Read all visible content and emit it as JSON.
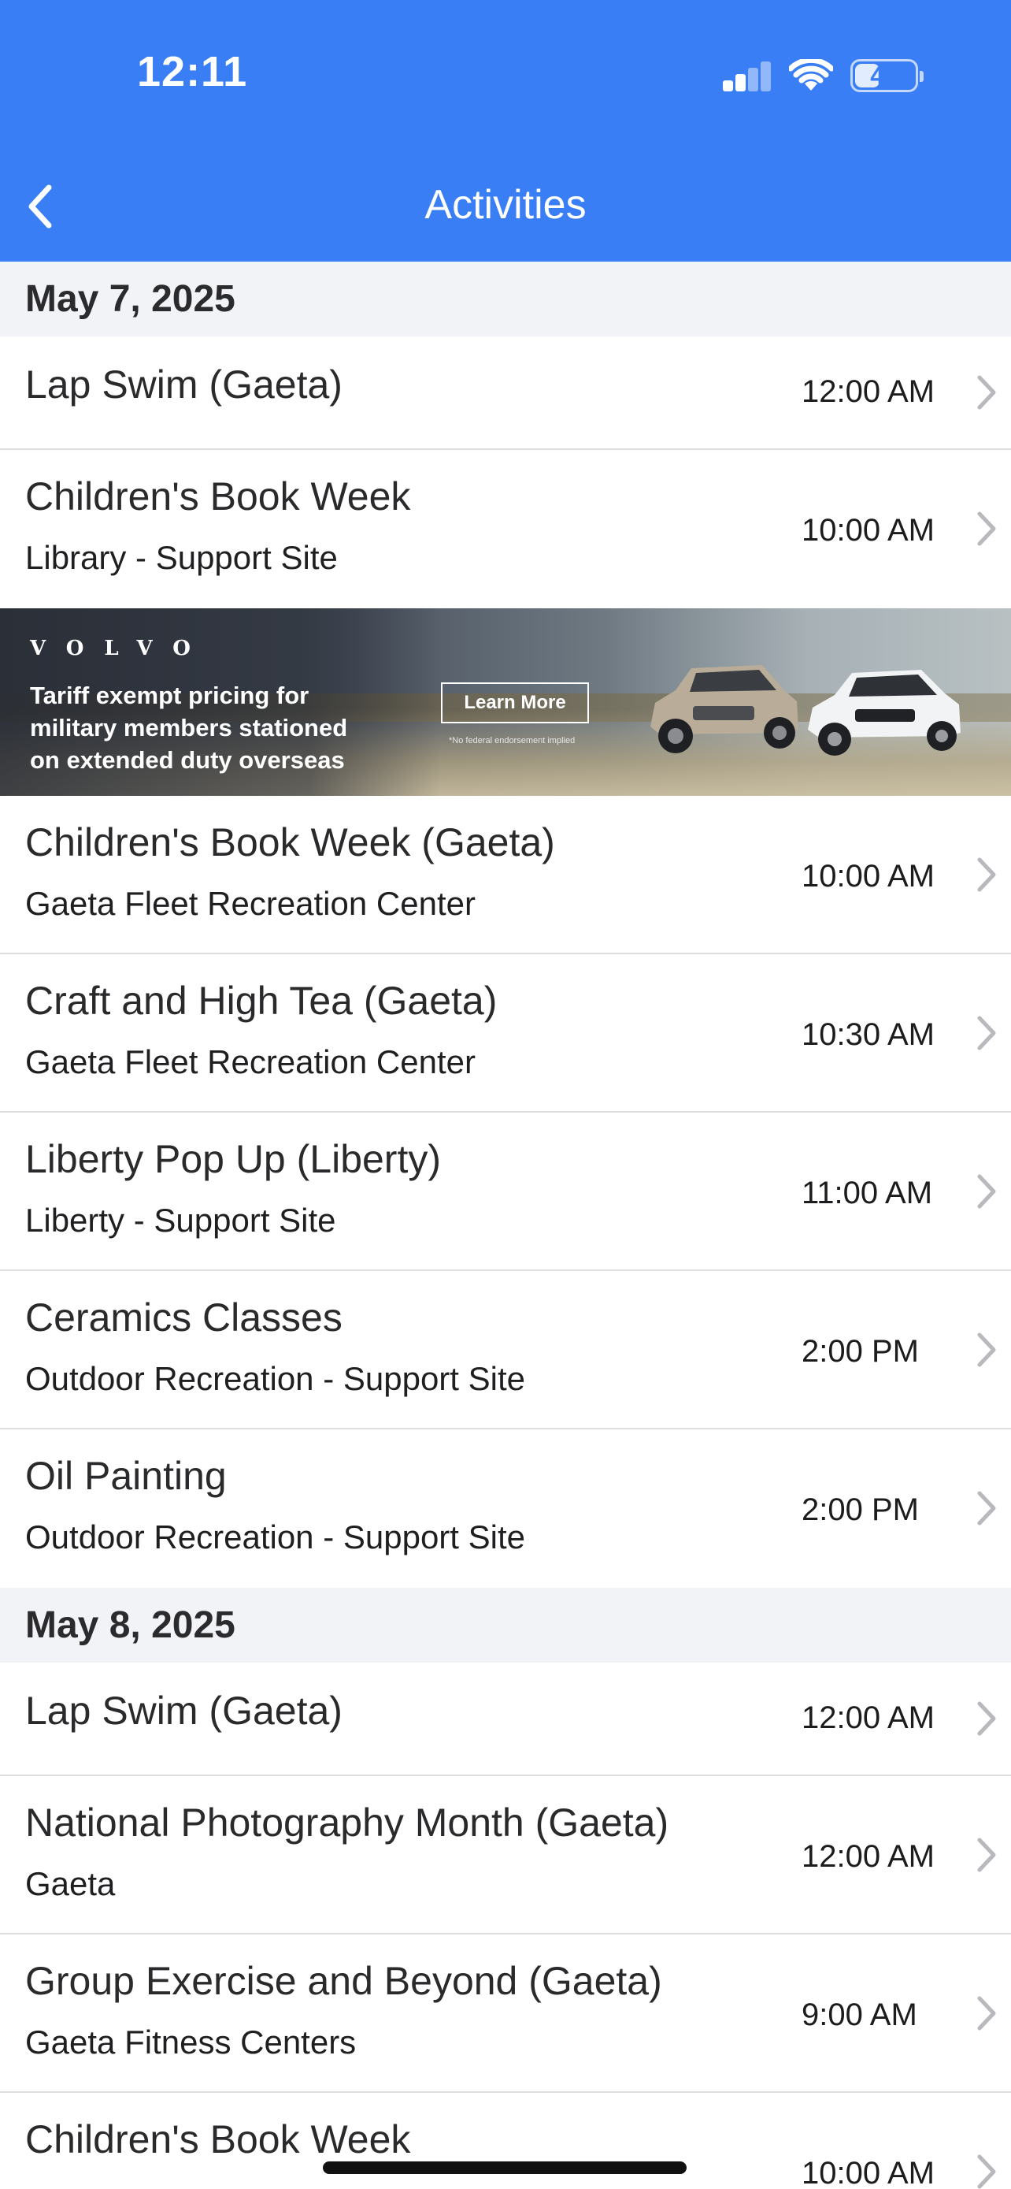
{
  "status_bar": {
    "time": "12:11",
    "battery": "42",
    "battery_level": 0.42
  },
  "nav": {
    "title": "Activities",
    "back_icon": "chevron-left-icon"
  },
  "sections": [
    {
      "date": "May 7, 2025",
      "rows_before_ad": [
        {
          "title": "Lap Swim (Gaeta)",
          "subtitle": "",
          "time": "12:00 AM"
        },
        {
          "title": "Children's Book Week",
          "subtitle": "Library - Support Site",
          "time": "10:00 AM"
        }
      ],
      "rows_after_ad": [
        {
          "title": "Children's Book Week (Gaeta)",
          "subtitle": "Gaeta Fleet Recreation Center",
          "time": "10:00 AM"
        },
        {
          "title": "Craft and High Tea (Gaeta)",
          "subtitle": "Gaeta Fleet Recreation Center",
          "time": "10:30 AM"
        },
        {
          "title": "Liberty Pop Up (Liberty)",
          "subtitle": "Liberty - Support Site",
          "time": "11:00 AM"
        },
        {
          "title": "Ceramics Classes",
          "subtitle": "Outdoor Recreation - Support Site",
          "time": "2:00 PM"
        },
        {
          "title": "Oil Painting",
          "subtitle": "Outdoor Recreation - Support Site",
          "time": "2:00 PM"
        }
      ]
    },
    {
      "date": "May 8, 2025",
      "rows": [
        {
          "title": "Lap Swim (Gaeta)",
          "subtitle": "",
          "time": "12:00 AM"
        },
        {
          "title": "National Photography Month (Gaeta)",
          "subtitle": "Gaeta",
          "time": "12:00 AM"
        },
        {
          "title": "Group Exercise and Beyond (Gaeta)",
          "subtitle": "Gaeta Fitness Centers",
          "time": "9:00 AM"
        },
        {
          "title": "Children's Book Week",
          "subtitle": "",
          "time": "10:00 AM"
        }
      ]
    }
  ],
  "ad": {
    "brand": "VOLVO",
    "lines": [
      "Tariff exempt pricing for",
      "military members stationed",
      "on extended duty overseas"
    ],
    "button": "Learn More",
    "disclaimer": "*No federal endorsement implied"
  },
  "colors": {
    "header": "#3a7ef5",
    "section_bg": "#f2f3f7",
    "divider": "#dedede",
    "chevron": "#b8b8bd"
  }
}
